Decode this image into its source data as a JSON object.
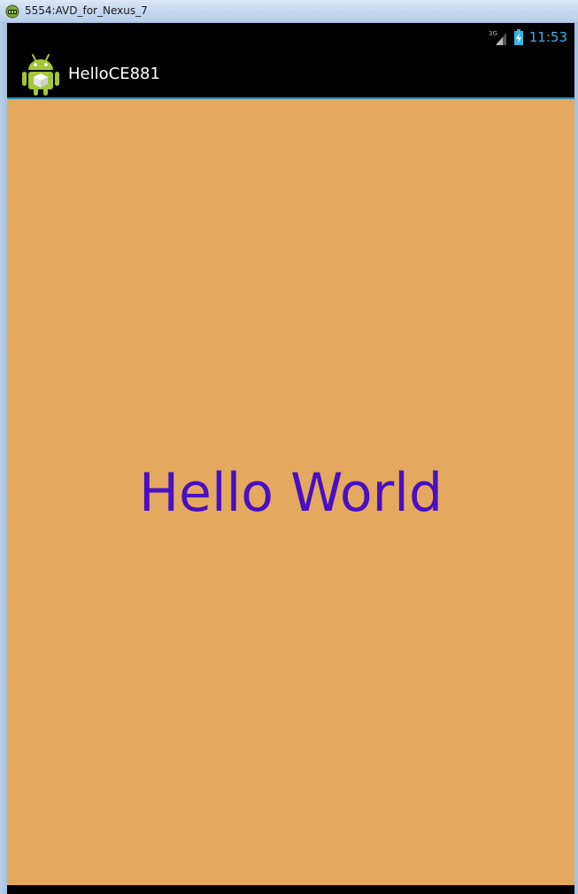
{
  "window": {
    "title": "5554:AVD_for_Nexus_7",
    "icon": "emulator-icon"
  },
  "status_bar": {
    "network": "3G",
    "signal_icon": "signal-3g-icon",
    "battery_icon": "battery-charging-icon",
    "time": "11:53"
  },
  "action_bar": {
    "app_icon": "android-robot-icon",
    "title": "HelloCE881"
  },
  "content": {
    "text": "Hello World"
  },
  "colors": {
    "content_background": "#e4a95e",
    "hello_text": "#4a0fc2",
    "status_time": "#33b5e5",
    "action_bar_divider": "#2f8bb3"
  }
}
